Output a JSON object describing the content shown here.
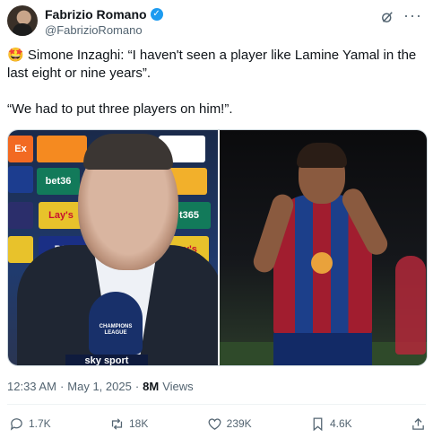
{
  "author": {
    "name": "Fabrizio Romano",
    "handle": "@FabrizioRomano",
    "verified_mark": "✓"
  },
  "header_icons": {
    "grok": "grok-icon",
    "more": "···"
  },
  "tweet": {
    "emoji": "🤩",
    "line1": "Simone Inzaghi: “I haven't seen a player like Lamine Yamal in the last eight or nine years”.",
    "line2": "“We had to put three players on him!”."
  },
  "media": {
    "left_sponsors": [
      "Ex",
      "Lay's",
      "bet36",
      "Lay's",
      "t365",
      "Lay's",
      "PS5"
    ],
    "mic_text": "CHAMPIONS LEAGUE",
    "broadcaster": "sky sport"
  },
  "meta": {
    "time": "12:33 AM",
    "separator": "·",
    "date": "May 1, 2025",
    "views_count": "8M",
    "views_label": "Views"
  },
  "actions": {
    "replies": "1.7K",
    "reposts": "18K",
    "likes": "239K",
    "bookmarks": "4.6K"
  },
  "colors": {
    "text": "#0f1419",
    "secondary": "#536471",
    "verified": "#1d9bf0",
    "border": "#cfd9de"
  }
}
